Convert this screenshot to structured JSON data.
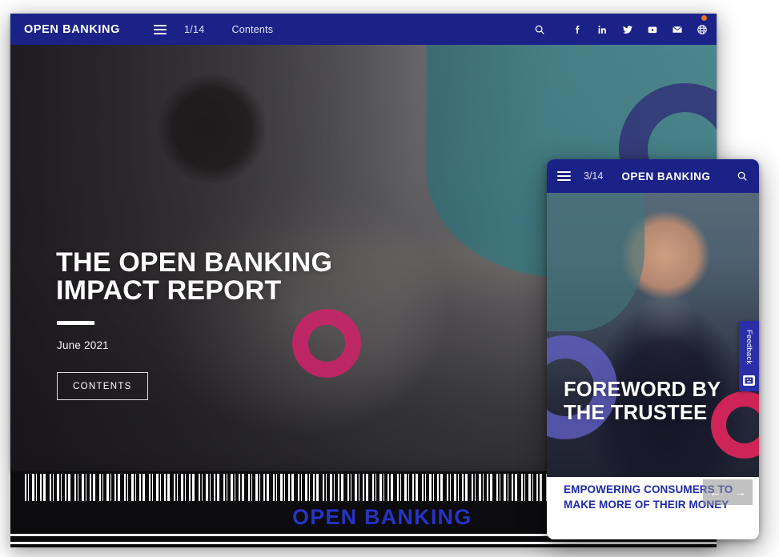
{
  "desktop": {
    "topbar": {
      "wordmark": "OPEN BANKING",
      "menu_icon": "hamburger-menu-icon",
      "page_count": "1/14",
      "nav_link": "Contents",
      "icons": [
        {
          "name": "search-icon",
          "label": "Search"
        },
        {
          "name": "facebook-icon",
          "label": "Facebook"
        },
        {
          "name": "linkedin-icon",
          "label": "LinkedIn"
        },
        {
          "name": "twitter-icon",
          "label": "Twitter"
        },
        {
          "name": "youtube-icon",
          "label": "YouTube"
        },
        {
          "name": "email-icon",
          "label": "Email"
        },
        {
          "name": "globe-icon",
          "label": "Website"
        }
      ],
      "notification_dot_color": "#e8751a",
      "background_color": "#1a2288"
    },
    "hero": {
      "title": "THE OPEN BANKING IMPACT REPORT",
      "date": "June 2021",
      "button_label": "CONTENTS",
      "accent_pink": "#d81e6a",
      "accent_navy_ring": "#33347e",
      "accent_teal": "#1c8e98"
    }
  },
  "footer": {
    "wordmark": "OPEN BANKING",
    "wordmark_color": "#2733c4",
    "background_color": "#0c0b0d"
  },
  "mobile": {
    "topbar": {
      "menu_icon": "hamburger-menu-icon",
      "page_count": "3/14",
      "wordmark": "OPEN BANKING",
      "search_icon": "search-icon",
      "background_color": "#1a2288"
    },
    "hero": {
      "title": "FOREWORD BY THE TRUSTEE",
      "accent_purple_ring": "#5f5ec0",
      "accent_pink_ring": "#cf2457",
      "accent_teal": "#42767d"
    },
    "caption": {
      "text": "EMPOWERING CONSUMERS TO MAKE MORE OF THEIR MONEY",
      "text_color": "#1d2aa8"
    },
    "nav": {
      "prev_label": "←",
      "next_label": "→"
    }
  },
  "feedback": {
    "label": "Feedback",
    "icon": "feedback-face-icon",
    "background_color": "#2a2fa8"
  }
}
